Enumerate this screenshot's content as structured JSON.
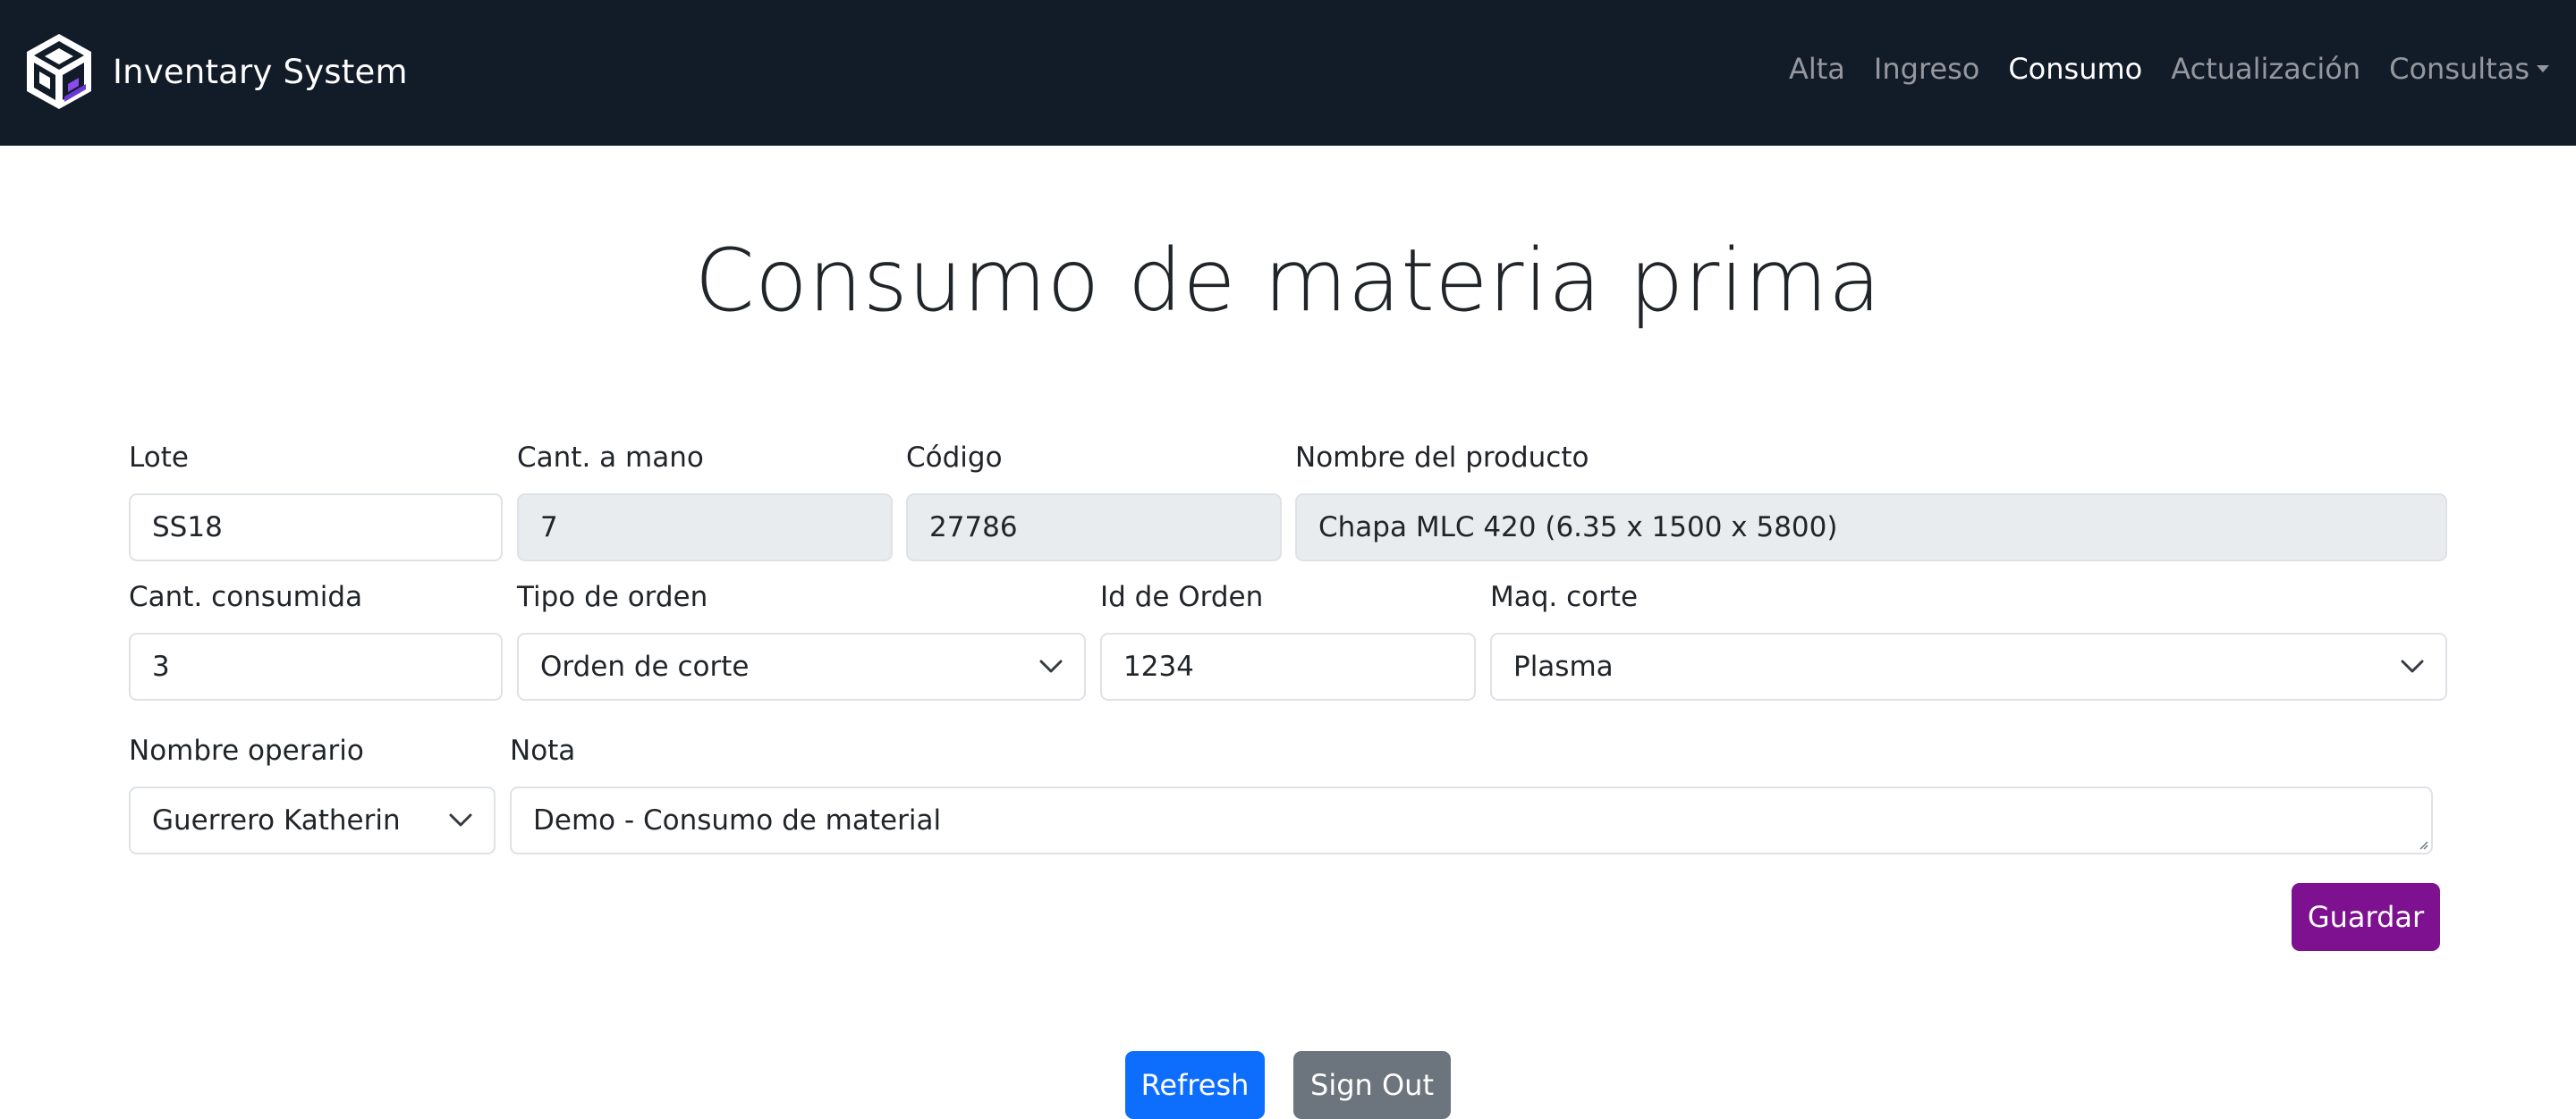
{
  "navbar": {
    "brand": "Inventary System",
    "links": [
      {
        "label": "Alta"
      },
      {
        "label": "Ingreso"
      },
      {
        "label": "Consumo"
      },
      {
        "label": "Actualización"
      },
      {
        "label": "Consultas"
      }
    ],
    "active": "Consumo",
    "logo_icon": "cube-logo-icon"
  },
  "page": {
    "title": "Consumo de materia prima"
  },
  "form": {
    "lote": {
      "label": "Lote",
      "value": "SS18"
    },
    "cant_mano": {
      "label": "Cant. a mano",
      "value": "7"
    },
    "codigo": {
      "label": "Código",
      "value": "27786"
    },
    "nombre_producto": {
      "label": "Nombre del producto",
      "value": "Chapa MLC 420 (6.35 x 1500 x 5800)"
    },
    "cant_consumida": {
      "label": "Cant. consumida",
      "value": "3"
    },
    "tipo_orden": {
      "label": "Tipo de orden",
      "value": "Orden de corte"
    },
    "id_orden": {
      "label": "Id de Orden",
      "value": "1234"
    },
    "maq_corte": {
      "label": "Maq. corte",
      "value": "Plasma"
    },
    "operario": {
      "label": "Nombre operario",
      "value": "Guerrero Katherin"
    },
    "nota": {
      "label": "Nota",
      "value": "Demo -  Consumo de material"
    }
  },
  "buttons": {
    "save": "Guardar",
    "refresh": "Refresh",
    "signout": "Sign Out"
  },
  "colors": {
    "navbar_bg": "#121b28",
    "save_button": "#7d1190",
    "refresh_button": "#0d6efd",
    "signout_button": "#6c757d",
    "readonly_bg": "#e9ecef"
  }
}
